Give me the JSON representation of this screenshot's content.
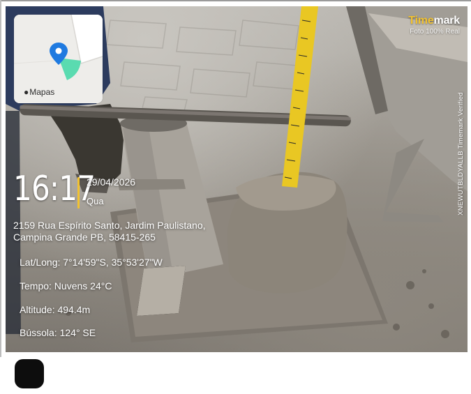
{
  "map": {
    "label": "Mapas",
    "pin_icon": "location-pin-icon",
    "map_logo_icon": "apple-logo-icon"
  },
  "brand": {
    "name_part1": "Time",
    "name_part2": "mark",
    "subtitle": "Foto 100% Real",
    "accent": "#f2c230"
  },
  "verified_text": "XNEWUTBLDYALLB Timemark Verified",
  "stamp": {
    "time": "16:17",
    "date": "29/04/2026",
    "weekday": "Qua",
    "address_line1": "2159 Rua Espírito Santo, Jardim Paulistano,",
    "address_line2": "Campina Grande PB, 58415-265",
    "coords": "Lat/Long: 7°14'59\"S, 35°53'27\"W",
    "weather": "Tempo: Nuvens 24°C",
    "altitude": "Altitude: 494.4m",
    "compass": "Bússola: 124° SE"
  },
  "footer": {
    "avatar_color": "#0d0d0d"
  }
}
